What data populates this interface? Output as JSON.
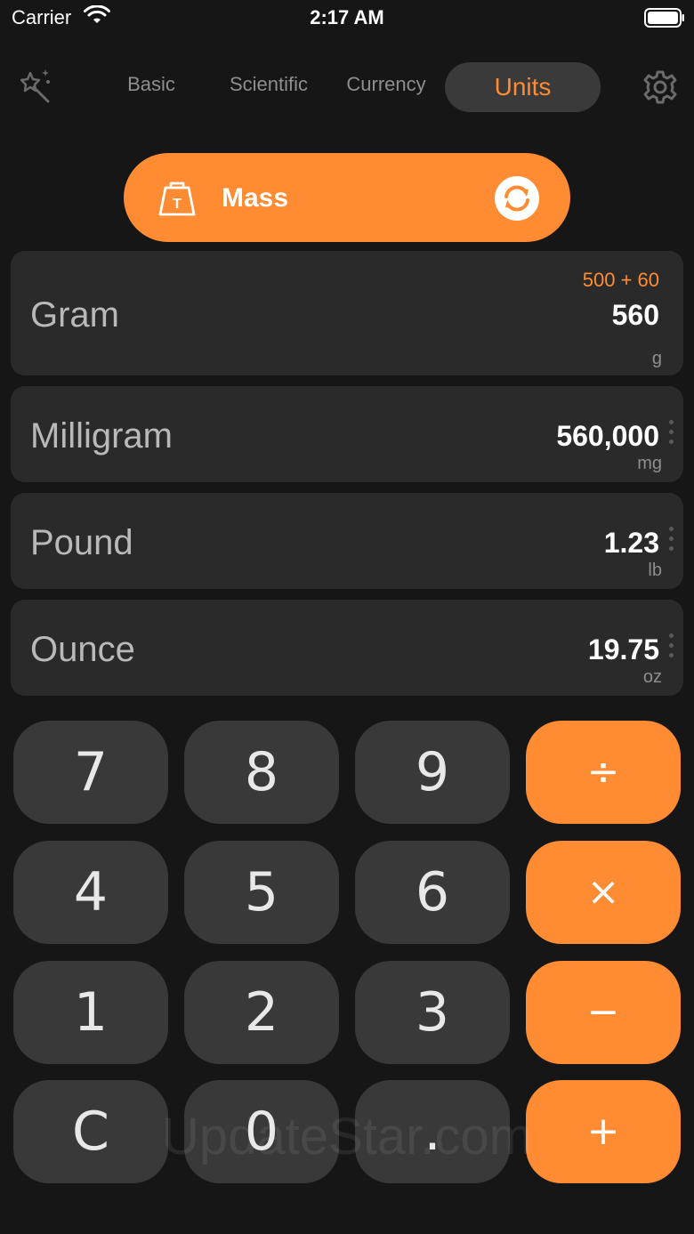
{
  "status_bar": {
    "carrier": "Carrier",
    "time": "2:17 AM"
  },
  "nav": {
    "tabs": [
      {
        "label": "Basic",
        "active": false
      },
      {
        "label": "Scientific",
        "active": false
      },
      {
        "label": "Currency",
        "active": false
      },
      {
        "label": "Units",
        "active": true
      }
    ]
  },
  "category": {
    "label": "Mass",
    "icon": "weight-icon"
  },
  "units": [
    {
      "name": "Gram",
      "expression": "500 + 60",
      "value": "560",
      "abbr": "g"
    },
    {
      "name": "Milligram",
      "value": "560,000",
      "abbr": "mg"
    },
    {
      "name": "Pound",
      "value": "1.23",
      "abbr": "lb"
    },
    {
      "name": "Ounce",
      "value": "19.75",
      "abbr": "oz"
    }
  ],
  "keypad": {
    "k7": "7",
    "k8": "8",
    "k9": "9",
    "divide": "÷",
    "k4": "4",
    "k5": "5",
    "k6": "6",
    "multiply": "×",
    "k1": "1",
    "k2": "2",
    "k3": "3",
    "minus": "−",
    "clear": "C",
    "k0": "0",
    "dot": ".",
    "plus": "+"
  },
  "watermark": "UpdateStar.com",
  "colors": {
    "accent": "#ff8c33",
    "background": "#161616",
    "row": "#2a2a2a",
    "key": "#393939"
  }
}
